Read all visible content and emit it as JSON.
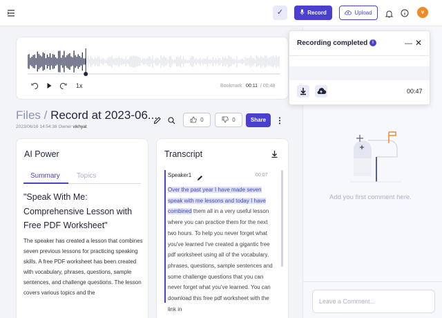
{
  "topbar": {
    "menu_icon": "sidebar-toggle-icon",
    "check_icon": "check-icon",
    "record_label": "Record",
    "upload_label": "Upload",
    "bell_icon": "bell-icon",
    "info_icon": "info-icon",
    "avatar_initial": "v",
    "accent": "#4a3fcf"
  },
  "player": {
    "speed": "1x",
    "bookmark_label": "Bookmark",
    "current_time": "00:11",
    "total_time": "00:48",
    "progress": 0.23
  },
  "file": {
    "crumb": "Files",
    "separator": " / ",
    "title": "Record at 2023-06...",
    "date": "2023/06/16 14:54:38",
    "owner_label": "Owner",
    "owner": "vikhyat",
    "likes": "0",
    "dislikes": "0",
    "share_label": "Share"
  },
  "ai_power": {
    "heading": "AI Power",
    "tabs": [
      "Summary",
      "Topics"
    ],
    "summary_title": "\"Speak With Me: Comprehensive Lesson with Free PDF Worksheet\"",
    "summary_body": "The speaker has created a lesson that combines seven previous lessons for practicing speaking skills. A free PDF worksheet has been created with vocabulary, phrases, questions, sample sentences, and challenge questions. The lesson covers various topics and the"
  },
  "transcript": {
    "heading": "Transcript",
    "speaker": "Speaker1",
    "segment_time": "00:07",
    "highlighted_text": "Over the past year I have made seven speak with me lessons and today I have combined",
    "rest_text": " them all in a very useful lesson where you can practice them for the next two hours. To help you never forget what you've learned I've created a gigantic free pdf worksheet using all of the vocabulary, phrases, questions, sample sentences and some challenge questions that you can never forget what you've learned. You can download this free pdf worksheet with the link in"
  },
  "comments": {
    "empty_text": "Add you first comment here.",
    "placeholder": "Leave a Comment..."
  },
  "popup": {
    "title": "Recording completed",
    "duration": "00:47"
  }
}
